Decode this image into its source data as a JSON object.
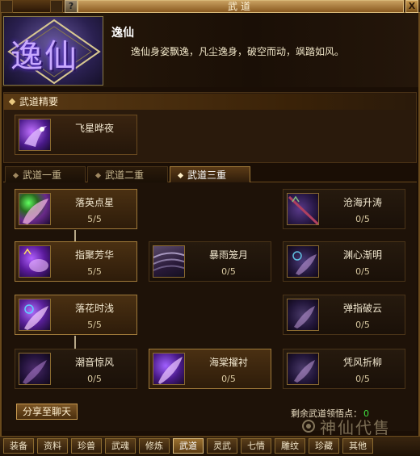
{
  "window": {
    "title": "武道",
    "help_label": "?",
    "close_label": "X"
  },
  "path": {
    "emblem_char": "逸仙",
    "name": "逸仙",
    "description": "逸仙身姿飘逸，凡尘逸身，破空而动，飒踏如风。"
  },
  "essence": {
    "section_title": "武道精要",
    "skill": {
      "name": "飞星晔夜"
    }
  },
  "tabs": [
    {
      "label": "武道一重",
      "active": false
    },
    {
      "label": "武道二重",
      "active": false
    },
    {
      "label": "武道三重",
      "active": true
    }
  ],
  "skills": [
    {
      "name": "落英点星",
      "level": "5/5"
    },
    {
      "name": "沧海升涛",
      "level": "0/5"
    },
    {
      "name": "指聚芳华",
      "level": "5/5"
    },
    {
      "name": "暴雨笼月",
      "level": "0/5"
    },
    {
      "name": "渊心渐明",
      "level": "0/5"
    },
    {
      "name": "落花时浅",
      "level": "5/5"
    },
    {
      "name": "弹指破云",
      "level": "0/5"
    },
    {
      "name": "潮音惊风",
      "level": "0/5"
    },
    {
      "name": "海棠擢衬",
      "level": "0/5"
    },
    {
      "name": "凭风折柳",
      "level": "0/5"
    }
  ],
  "share_button": "分享至聊天",
  "points": {
    "label": "剩余武道领悟点：",
    "value": "0"
  },
  "watermark": "神仙代售",
  "bottom_tabs": [
    {
      "label": "装备",
      "active": false
    },
    {
      "label": "资料",
      "active": false
    },
    {
      "label": "珍兽",
      "active": false
    },
    {
      "label": "武魂",
      "active": false
    },
    {
      "label": "修炼",
      "active": false
    },
    {
      "label": "武道",
      "active": true
    },
    {
      "label": "灵武",
      "active": false
    },
    {
      "label": "七情",
      "active": false
    },
    {
      "label": "雕纹",
      "active": false
    },
    {
      "label": "珍藏",
      "active": false
    },
    {
      "label": "其他",
      "active": false
    }
  ]
}
